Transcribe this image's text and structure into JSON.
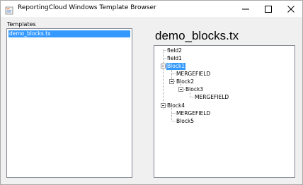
{
  "window": {
    "title": "ReportingCloud Windows Template Browser"
  },
  "templates_panel": {
    "label": "Templates",
    "items": [
      "demo_blocks.tx"
    ],
    "selected_index": 0
  },
  "detail_panel": {
    "heading": "demo_blocks.tx",
    "tree": {
      "field2": "field2",
      "field1": "field1",
      "block1": "Block1",
      "block1_mergefield": "MERGEFIELD",
      "block2": "Block2",
      "block3": "Block3",
      "block3_mergefield": "MERGEFIELD",
      "block4": "Block4",
      "block4_mergefield": "MERGEFIELD",
      "block5": "Block5"
    },
    "selected_node": "Block1"
  },
  "icons": {
    "app": "reportingcloud-app-icon",
    "minimize": "minimize-icon",
    "maximize": "maximize-icon",
    "close": "close-icon",
    "expander": "collapse-minus-icon"
  },
  "colors": {
    "selection": "#3399ff",
    "window_bg": "#f0f0f0",
    "titlebar_bg": "#ffffff"
  }
}
